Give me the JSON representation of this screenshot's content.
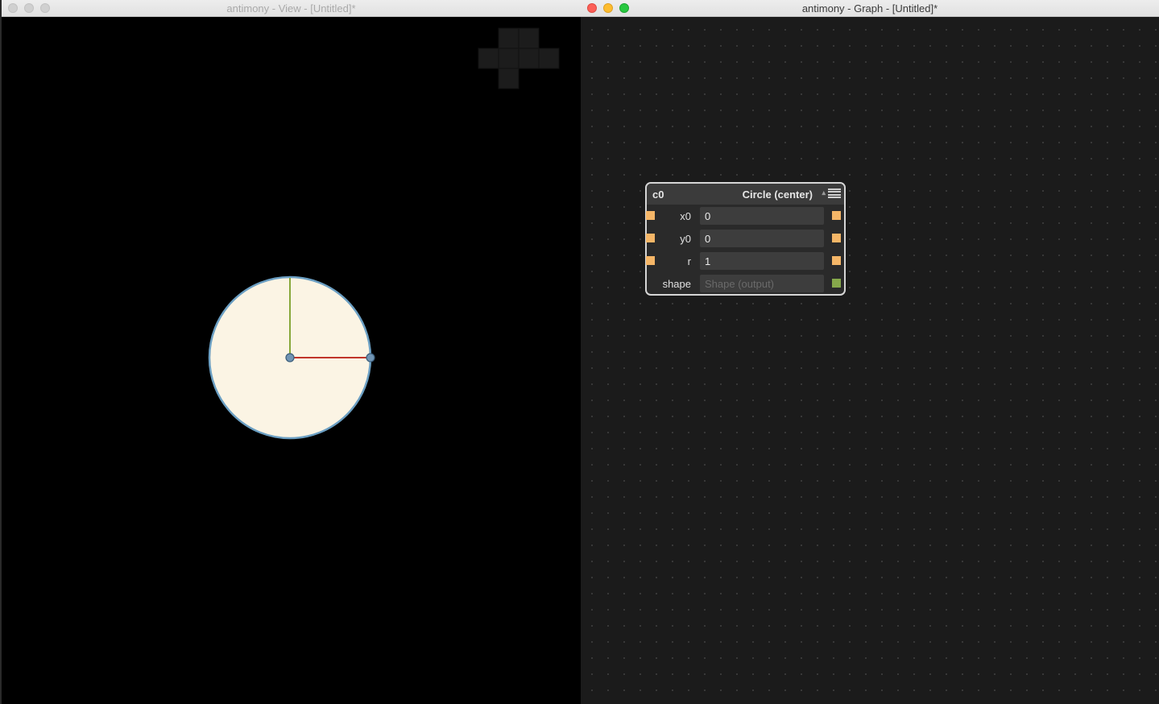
{
  "view_window": {
    "title": "antimony - View - [Untitled]*"
  },
  "graph_window": {
    "title": "antimony - Graph - [Untitled]*"
  },
  "node": {
    "name": "c0",
    "type": "Circle (center)",
    "collapse_glyph": "▴",
    "rows": [
      {
        "label": "x0",
        "value": "0",
        "port_in": true,
        "port_out": true
      },
      {
        "label": "y0",
        "value": "0",
        "port_in": true,
        "port_out": true
      },
      {
        "label": "r",
        "value": "1",
        "port_in": true,
        "port_out": true
      },
      {
        "label": "shape",
        "value": "Shape (output)",
        "port_in": false,
        "port_out": true
      }
    ]
  },
  "colors": {
    "input_port": "#f5b667",
    "shape_port": "#86a84b",
    "circle_fill": "#fbf4e4",
    "circle_stroke": "#6b9fc3",
    "x_axis": "#c0352a",
    "y_axis": "#88a83b"
  },
  "icons": {
    "node_menu": "hamburger-icon",
    "view_cube": "orientation-cross-icon"
  }
}
